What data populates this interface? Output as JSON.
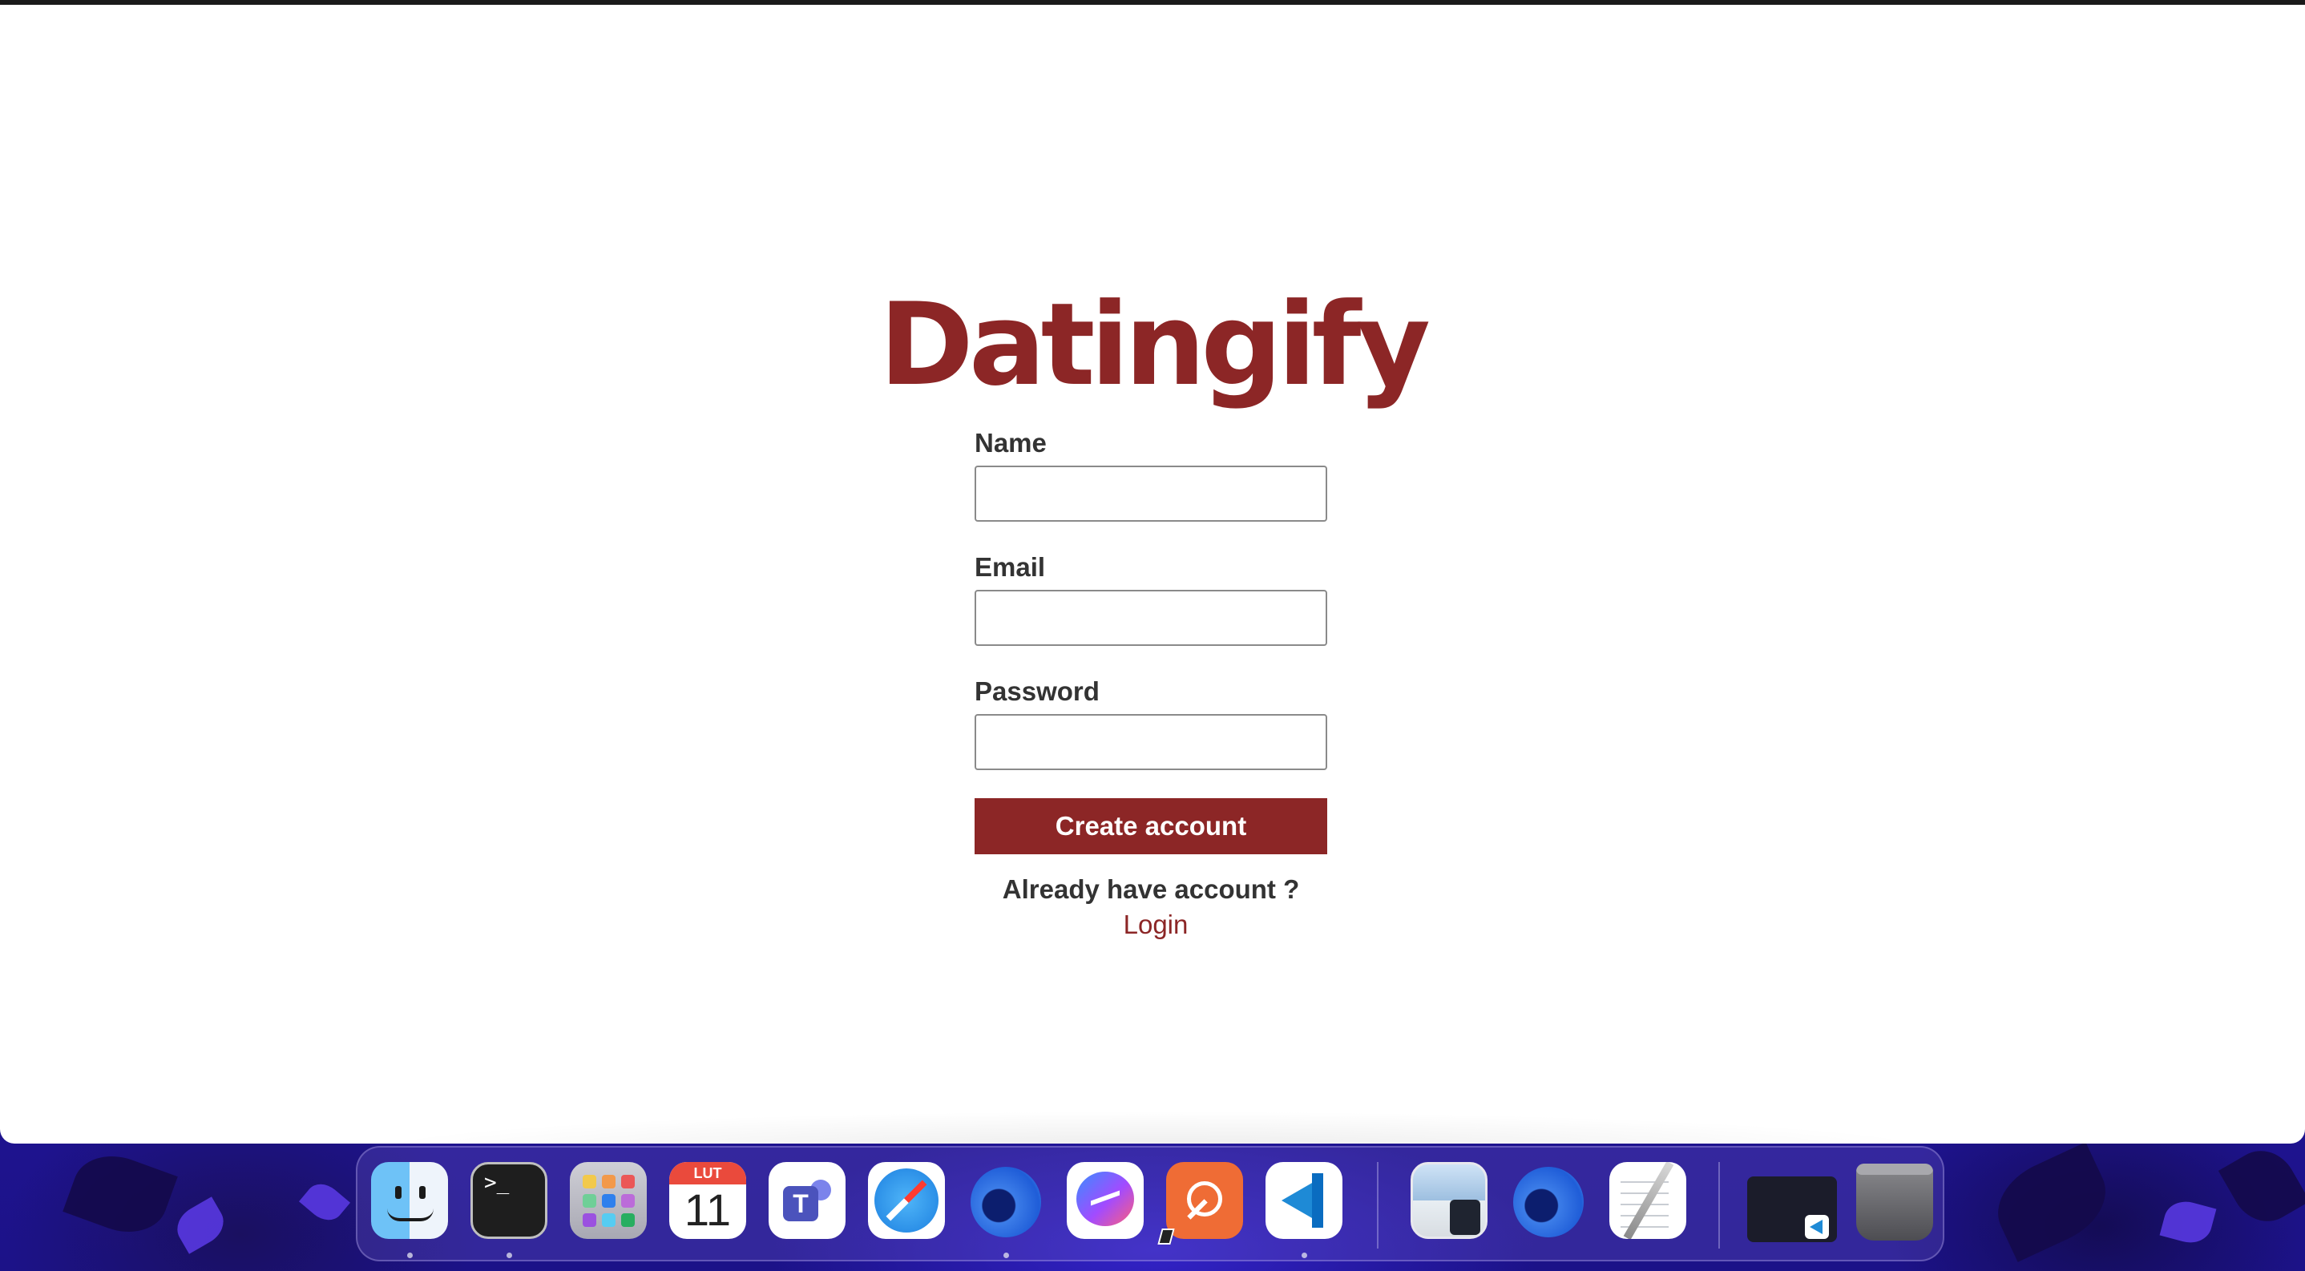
{
  "app": {
    "brand": "Datingify",
    "accent_color": "#8c2626"
  },
  "form": {
    "name_label": "Name",
    "name_value": "",
    "email_label": "Email",
    "email_value": "",
    "password_label": "Password",
    "password_value": "",
    "submit_label": "Create account",
    "login_prompt": "Already have account ?",
    "login_link": "Login"
  },
  "dock": {
    "items": [
      {
        "name": "Finder",
        "icon": "finder-icon",
        "running": true
      },
      {
        "name": "Terminal",
        "icon": "terminal-icon",
        "running": true
      },
      {
        "name": "Launchpad",
        "icon": "launchpad-icon",
        "running": false
      },
      {
        "name": "Calendar",
        "icon": "calendar-icon",
        "running": false,
        "month": "LUT",
        "day": "11"
      },
      {
        "name": "Microsoft Teams",
        "icon": "teams-icon",
        "running": false
      },
      {
        "name": "Safari",
        "icon": "safari-icon",
        "running": false
      },
      {
        "name": "Firefox",
        "icon": "firefox-icon",
        "running": true
      },
      {
        "name": "Messenger",
        "icon": "messenger-icon",
        "running": false
      },
      {
        "name": "Postman",
        "icon": "postman-icon",
        "running": false
      },
      {
        "name": "Visual Studio Code",
        "icon": "vscode-icon",
        "running": true
      },
      {
        "name": "Preview",
        "icon": "preview-icon",
        "running": false
      },
      {
        "name": "Firefox Developer",
        "icon": "firefox-icon",
        "running": false
      },
      {
        "name": "TextEdit",
        "icon": "textedit-icon",
        "running": false
      },
      {
        "name": "VS Code window",
        "icon": "window-thumbnail-icon",
        "running": false
      },
      {
        "name": "Trash",
        "icon": "trash-icon",
        "running": false
      }
    ]
  }
}
